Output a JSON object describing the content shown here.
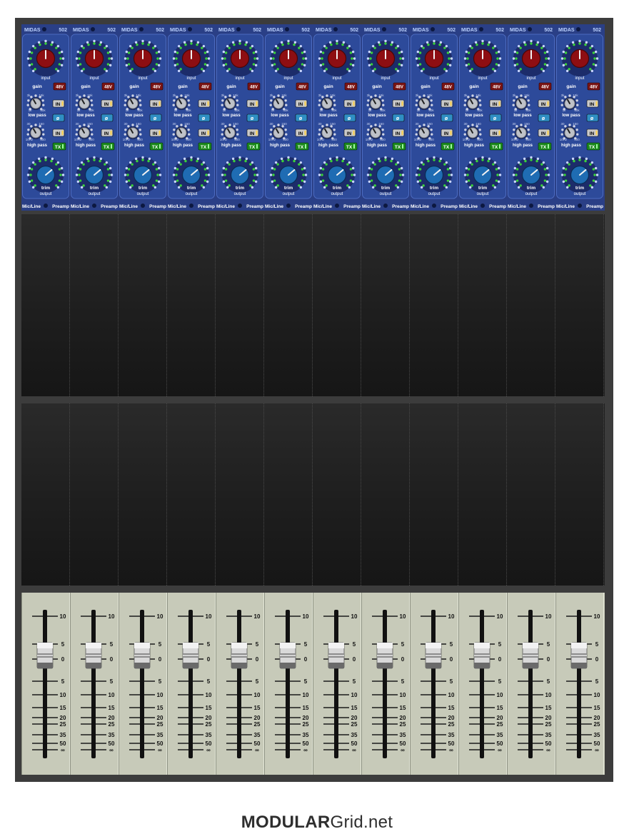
{
  "preamp_module": {
    "brand": "MIDAS",
    "model": "502",
    "labels": {
      "input": "input",
      "gain": "gain",
      "phantom": "48V",
      "low_pass": "low pass",
      "high_pass": "high pass",
      "in": "IN",
      "phase": "ø",
      "tx": "TX",
      "trim": "trim",
      "output": "output",
      "bottom_left": "Mic/Line",
      "bottom_right": "Preamp",
      "lp_min": "1k",
      "lp_max": "40k",
      "lp_mid": "15k",
      "lp_low": "3k",
      "hp_min": "10Hz",
      "hp_max": "400",
      "hp_mid": "150",
      "hp_low": "30"
    },
    "count": 12
  },
  "fader_module": {
    "scale": [
      "10",
      "5",
      "0",
      "5",
      "10",
      "15",
      "20",
      "25",
      "35",
      "50",
      "∞"
    ],
    "count": 12
  },
  "empty_rows": 2,
  "colors": {
    "panel_blue": "#2a3f86",
    "gain_red": "#8e0e12",
    "trim_blue": "#1f6cb3",
    "led_green": "#3ad13a",
    "fader_panel": "#c7cab9",
    "rack": "#3c3c3c"
  },
  "footer": {
    "brand_bold": "MODULAR",
    "brand_rest": "Grid.net"
  }
}
